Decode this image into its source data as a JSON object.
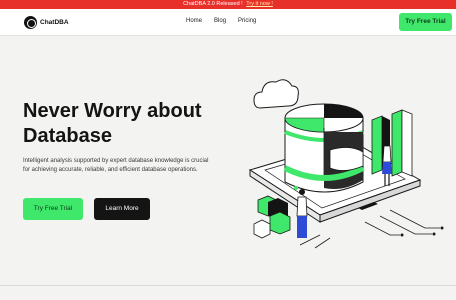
{
  "announcement": {
    "text": "ChatDBA 2.0 Released !",
    "link": "Try it now !"
  },
  "brand": {
    "name": "ChatDBA",
    "icon": "chatdba-logo-icon"
  },
  "nav": {
    "links": [
      "Home",
      "Blog",
      "Pricing"
    ],
    "cta": "Try Free Trial"
  },
  "hero": {
    "title_line1": "Never Worry about",
    "title_line2": "Database",
    "description": "Intelligent analysis supported by expert database knowledge is crucial for achieving accurate, reliable, and efficient database operations.",
    "primary_button": "Try Free Trial",
    "secondary_button": "Learn More"
  },
  "colors": {
    "accent": "#3fe86a",
    "announcement_bg": "#e8302b",
    "dark": "#141414"
  }
}
